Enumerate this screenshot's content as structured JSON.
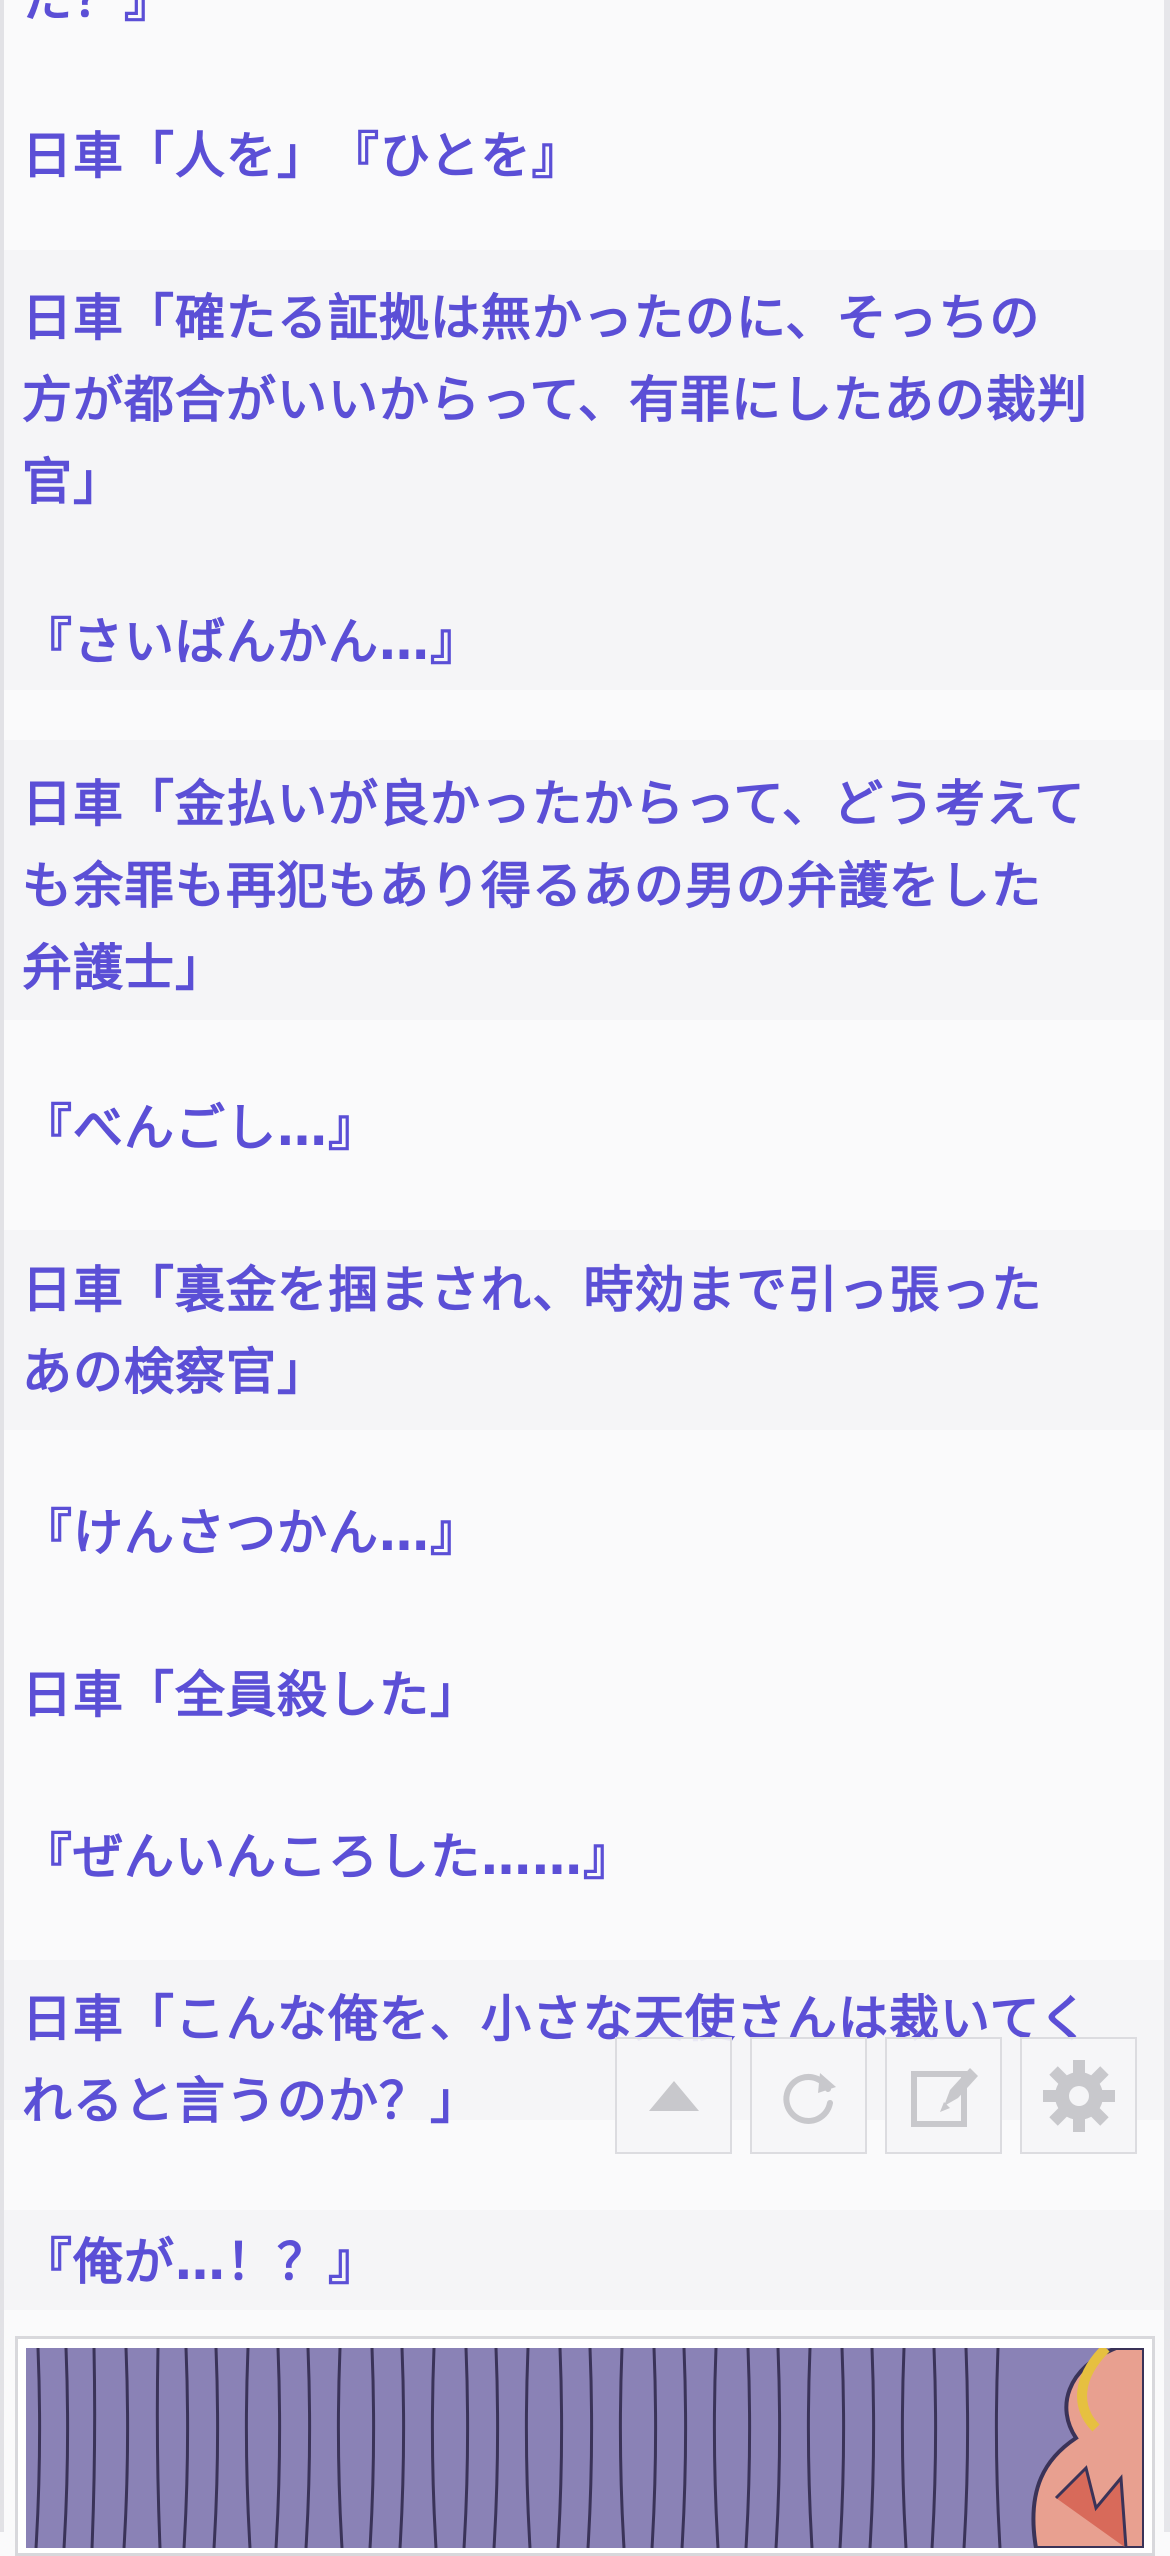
{
  "story": {
    "lines": [
      "た？』",
      "日車「人を」　『ひとを』",
      "日車「確たる証拠は無かったのに、そっちの\n方が都合がいいからって、有罪にしたあの裁判\n官」",
      "『さいばんかん…』",
      "日車「金払いが良かったからって、どう考えて\nも余罪も再犯もあり得るあの男の弁護をした\n弁護士」",
      "『べんごし…』",
      "日車「裏金を掴まされ、時効まで引っ張った\nあの検察官」",
      "『けんさつかん…』",
      "日車「全員殺した」",
      "『ぜんいんころした……』",
      "日車「こんな俺を、小さな天使さんは裁いてく\nれると言うのか？」",
      "『俺が…！？』"
    ]
  },
  "toolbar": {
    "buttons": [
      {
        "name": "scroll-top-button",
        "icon": "triangle-up-icon"
      },
      {
        "name": "reload-button",
        "icon": "refresh-icon"
      },
      {
        "name": "edit-button",
        "icon": "pencil-square-icon"
      },
      {
        "name": "settings-button",
        "icon": "gear-icon"
      }
    ]
  },
  "colors": {
    "text": "#5b4fd6",
    "background": "#fafafb",
    "icon": "#c8c8cc",
    "image": "#8a82b6"
  }
}
